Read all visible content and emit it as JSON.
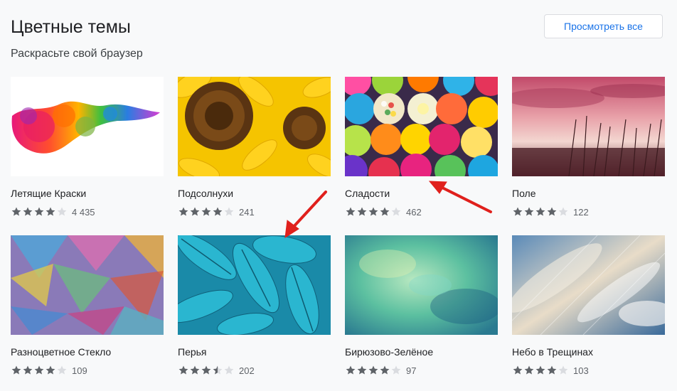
{
  "header": {
    "title": "Цветные темы",
    "subtitle": "Раскрасьте свой браузер",
    "view_all_label": "Просмотреть все"
  },
  "themes": [
    {
      "name": "Летящие Краски",
      "rating": 4,
      "count": "4 435"
    },
    {
      "name": "Подсолнухи",
      "rating": 4,
      "count": "241"
    },
    {
      "name": "Сладости",
      "rating": 4,
      "count": "462"
    },
    {
      "name": "Поле",
      "rating": 4,
      "count": "122"
    },
    {
      "name": "Разноцветное Стекло",
      "rating": 4,
      "count": "109"
    },
    {
      "name": "Перья",
      "rating": 3.5,
      "count": "202"
    },
    {
      "name": "Бирюзово-Зелёное",
      "rating": 4,
      "count": "97"
    },
    {
      "name": "Небо в Трещинах",
      "rating": 4,
      "count": "103"
    }
  ],
  "colors": {
    "accent": "#1a73e8",
    "star_filled": "#5f6368",
    "star_empty": "#dadce0",
    "arrow": "#e0201c"
  }
}
